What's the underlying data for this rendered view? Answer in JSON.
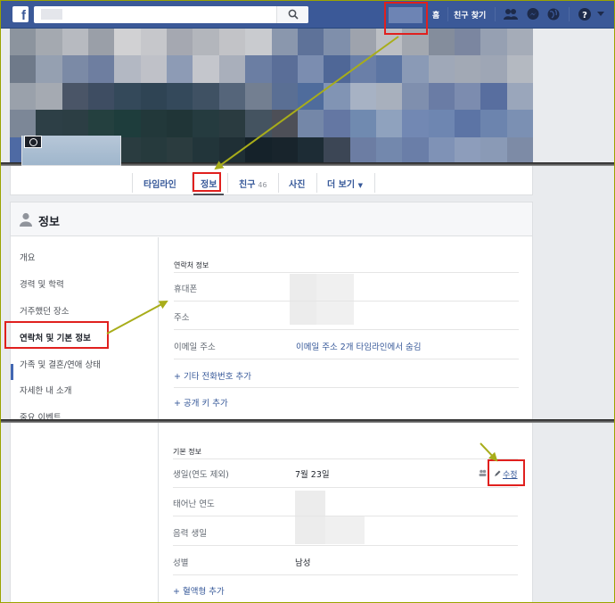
{
  "topbar": {
    "logo": "f",
    "home": "홈",
    "find_friends": "친구 찾기",
    "icons": [
      "friends-requests-icon",
      "messenger-icon",
      "globe-notifications-icon",
      "help-icon"
    ]
  },
  "tabs": [
    {
      "label": "타임라인"
    },
    {
      "label": "정보"
    },
    {
      "label": "친구",
      "count": "46"
    },
    {
      "label": "사진"
    },
    {
      "label": "더 보기"
    }
  ],
  "about": {
    "title": "정보",
    "nav": [
      "개요",
      "경력 및 학력",
      "거주했던 장소",
      "연락처 및 기본 정보",
      "가족 및 결혼/연애 상태",
      "자세한 내 소개",
      "중요 이벤트"
    ],
    "contact": {
      "section_title": "연락처 정보",
      "phone_label": "휴대폰",
      "address_label": "주소",
      "email_label": "이메일 주소",
      "email_value": "이메일 주소 2개 타임라인에서 숨김",
      "add_phone": "+ 기타 전화번호 추가",
      "add_key": "+ 공개 키 추가"
    },
    "basic": {
      "section_title": "기본 정보",
      "birthday_label": "생일(연도 제외)",
      "birthday_value": "7월 23일",
      "edit": "수정",
      "birth_year_label": "태어난 연도",
      "lunar_label": "음력 생일",
      "gender_label": "성별",
      "gender_value": "남성",
      "add_blood": "+ 혈액형 추가"
    }
  },
  "colors": {
    "brand": "#3b5998",
    "link": "#365899",
    "highlight": "#e0201e",
    "arrow": "#a8ad1a"
  }
}
